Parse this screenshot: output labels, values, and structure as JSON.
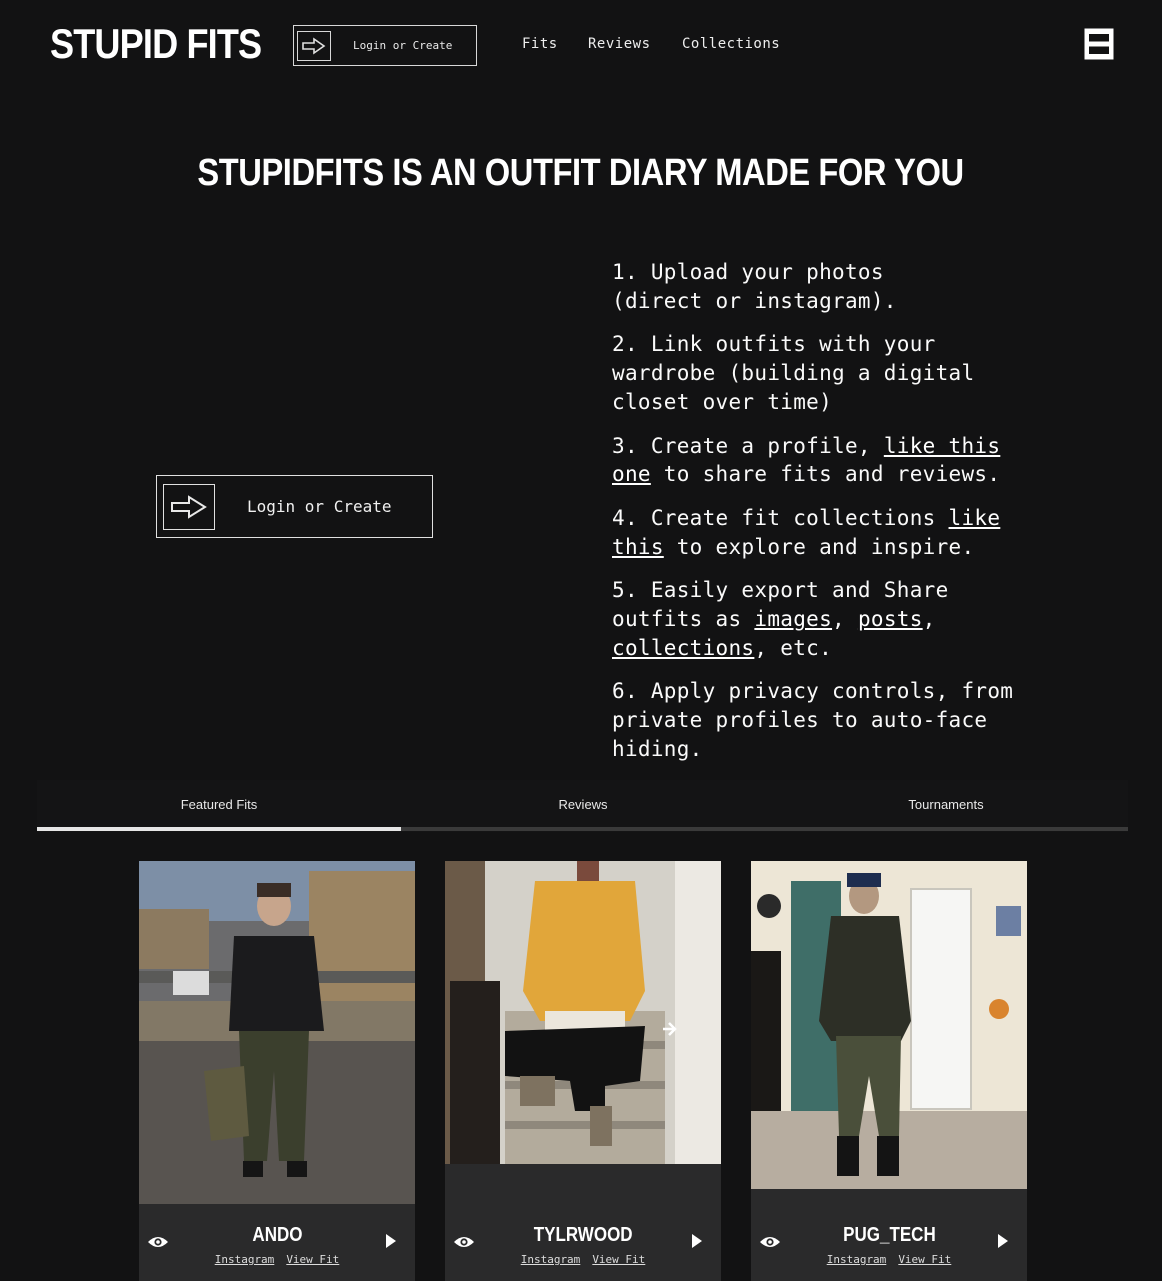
{
  "header": {
    "logo": "STUPID FITS",
    "login_label": "Login or Create",
    "nav": [
      "Fits",
      "Reviews",
      "Collections"
    ],
    "menu_icon": "menu-icon"
  },
  "hero": {
    "title": "STUPIDFITS IS AN OUTFIT DIARY MADE FOR YOU",
    "login_label": "Login or Create",
    "steps": [
      [
        {
          "t": "1. Upload your photos\n(direct or instagram)."
        }
      ],
      [
        {
          "t": "2. Link outfits with your\nwardrobe (building a digital\ncloset over time)"
        }
      ],
      [
        {
          "t": "3. Create a profile, "
        },
        {
          "t": "like this\none",
          "link": true
        },
        {
          "t": " to share fits and reviews."
        }
      ],
      [
        {
          "t": "4. Create fit collections "
        },
        {
          "t": "like\nthis",
          "link": true
        },
        {
          "t": " to explore and inspire."
        }
      ],
      [
        {
          "t": "5. Easily export and Share\noutfits as "
        },
        {
          "t": "images",
          "link": true
        },
        {
          "t": ", "
        },
        {
          "t": "posts",
          "link": true
        },
        {
          "t": ",\n"
        },
        {
          "t": "collections",
          "link": true
        },
        {
          "t": ", etc."
        }
      ],
      [
        {
          "t": "6. Apply privacy controls, from\nprivate profiles to auto-face\nhiding."
        }
      ]
    ]
  },
  "tabs": [
    "Featured Fits",
    "Reviews",
    "Tournaments"
  ],
  "cards": [
    {
      "username": "ANDO",
      "link1": "Instagram",
      "link2": "View Fit"
    },
    {
      "username": "TYLRWOOD",
      "link1": "Instagram",
      "link2": "View Fit"
    },
    {
      "username": "PUG_TECH",
      "link1": "Instagram",
      "link2": "View Fit"
    }
  ],
  "colors": {
    "background": "#121213",
    "card": "#2a2a2b",
    "text": "#ffffff",
    "accent_yellow": "#e1a63a",
    "jacket_olive": "#3f4630"
  }
}
